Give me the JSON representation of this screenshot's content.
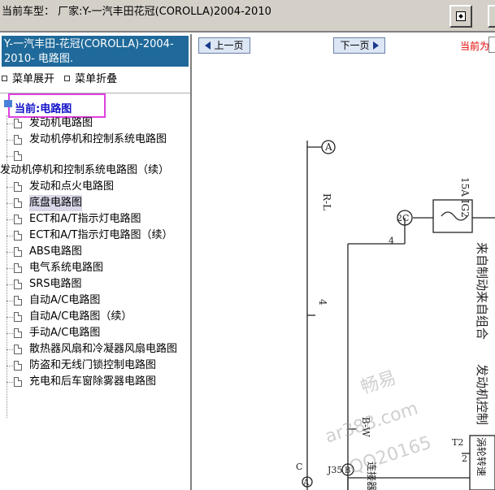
{
  "topbar": {
    "title": "当前车型：  厂家:Y-一汽丰田花冠(COROLLA)2004-2010"
  },
  "sidebar": {
    "header": "Y-一汽丰田-花冠(COROLLA)-2004-2010- 电路图.",
    "expand_label": "菜单展开",
    "collapse_label": "菜单折叠",
    "current_label": "当前:电路图",
    "items": [
      {
        "label": "发动机电路图"
      },
      {
        "label": "发动机停机和控制系统电路图"
      },
      {
        "label": ""
      },
      {
        "label": "发动机停机和控制系统电路图（续）"
      },
      {
        "label": "发动和点火电路图"
      },
      {
        "label": "底盘电路图"
      },
      {
        "label": "ECT和A/T指示灯电路图"
      },
      {
        "label": "ECT和A/T指示灯电路图（续）"
      },
      {
        "label": "ABS电路图"
      },
      {
        "label": "电气系统电路图"
      },
      {
        "label": "SRS电路图"
      },
      {
        "label": "自动A/C电路图"
      },
      {
        "label": "自动A/C电路图（续）"
      },
      {
        "label": "手动A/C电路图"
      },
      {
        "label": "散热器风扇和冷凝器风扇电路图"
      },
      {
        "label": "防盗和无线门锁控制电路图"
      },
      {
        "label": "充电和后车窗除雾器电路图"
      }
    ]
  },
  "main": {
    "prev_label": "上一页",
    "next_label": "下一页",
    "current_page_label": "当前为"
  },
  "diagram": {
    "labels": {
      "a": "A",
      "r_l": "R-L",
      "fuse": "15A IG2",
      "conn_2c": "2C",
      "pin_4": "4",
      "wire_4": "4",
      "b_w": "B-W",
      "from_brake": "来自制动",
      "from_combo": "来自组合",
      "engine_ctrl": "发动机控制",
      "t2": "T2",
      "turbine": "涡轮转速",
      "pin_2": "2",
      "c": "C",
      "a2": "A",
      "j35": "J35",
      "b": "B",
      "connector": "连接器"
    },
    "watermark": [
      "畅易",
      "ar388.com",
      "QQ20165"
    ]
  }
}
